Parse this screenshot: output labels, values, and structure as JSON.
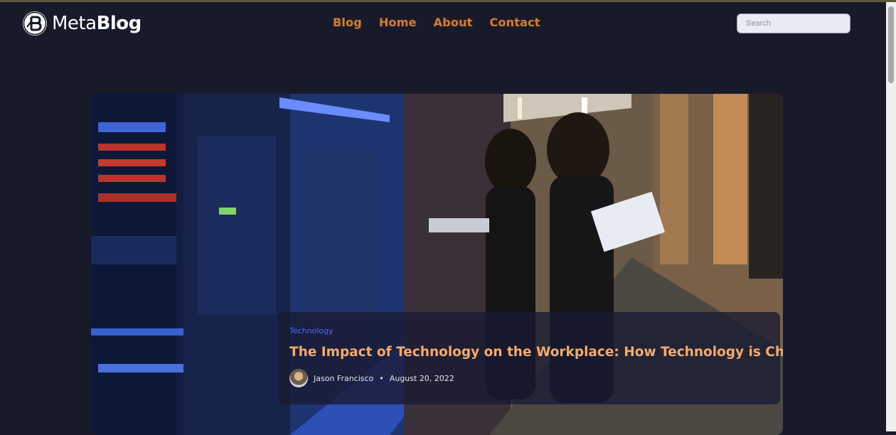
{
  "header": {
    "logo": {
      "light": "Meta",
      "bold": "Blog"
    },
    "nav": [
      {
        "label": "Blog"
      },
      {
        "label": "Home"
      },
      {
        "label": "About"
      },
      {
        "label": "Contact"
      }
    ],
    "search": {
      "placeholder": "Search"
    }
  },
  "hero": {
    "category": "Technology",
    "title": "The Impact of Technology on the Workplace: How Technology is Changing",
    "author": "Jason Francisco",
    "date": "August 20, 2022"
  },
  "colors": {
    "background": "#181a2a",
    "accent_title": "#f6a96c",
    "accent_tag": "#4b6bfb",
    "nav_link": "#c8804a"
  },
  "icons": [
    "metablog-logo-icon",
    "author-avatar"
  ]
}
